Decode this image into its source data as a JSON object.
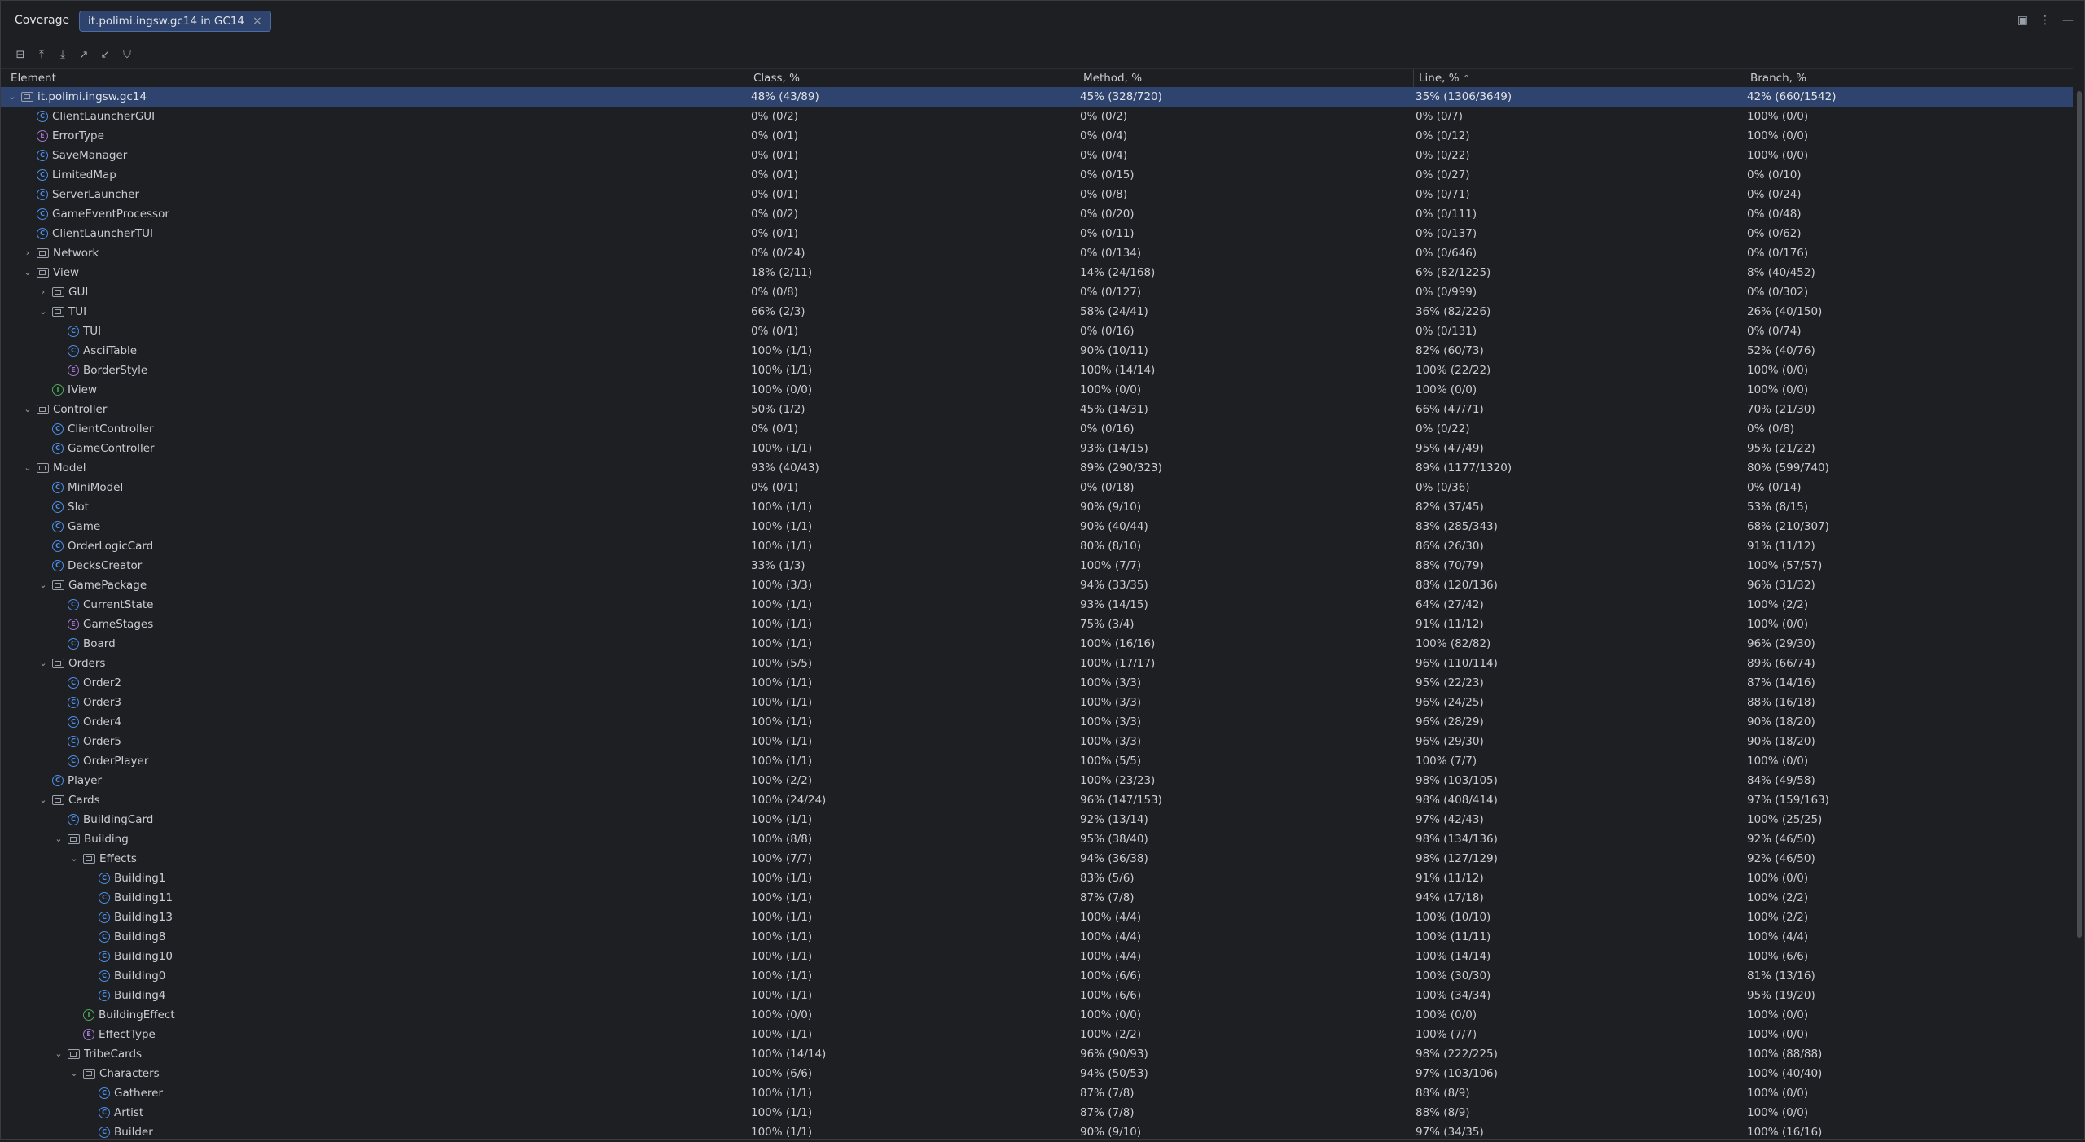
{
  "window": {
    "title": "Coverage",
    "tab_label": "it.polimi.ingsw.gc14 in GC14",
    "tab_close": "×"
  },
  "top_icons": [
    "layout-icon",
    "more-vertical-icon",
    "minimize-icon"
  ],
  "toolbar": [
    "import-icon",
    "collapse-all-icon",
    "expand-all-icon",
    "export-icon",
    "navigate-icon",
    "filter-icon"
  ],
  "columns": {
    "element": "Element",
    "class": "Class, %",
    "method": "Method, %",
    "line": "Line, %",
    "line_sort": "^",
    "branch": "Branch, %"
  },
  "rows": [
    {
      "name": "it.polimi.ingsw.gc14",
      "type": "pkg",
      "level": 0,
      "exp": "open",
      "class": "48% (43/89)",
      "method": "45% (328/720)",
      "line": "35% (1306/3649)",
      "branch": "42% (660/1542)",
      "sel": true
    },
    {
      "name": "ClientLauncherGUI",
      "type": "class",
      "level": 1,
      "exp": "",
      "class": "0% (0/2)",
      "method": "0% (0/2)",
      "line": "0% (0/7)",
      "branch": "100% (0/0)"
    },
    {
      "name": "ErrorType",
      "type": "enum",
      "level": 1,
      "exp": "",
      "class": "0% (0/1)",
      "method": "0% (0/4)",
      "line": "0% (0/12)",
      "branch": "100% (0/0)"
    },
    {
      "name": "SaveManager",
      "type": "class",
      "level": 1,
      "exp": "",
      "class": "0% (0/1)",
      "method": "0% (0/4)",
      "line": "0% (0/22)",
      "branch": "100% (0/0)"
    },
    {
      "name": "LimitedMap",
      "type": "class",
      "level": 1,
      "exp": "",
      "class": "0% (0/1)",
      "method": "0% (0/15)",
      "line": "0% (0/27)",
      "branch": "0% (0/10)"
    },
    {
      "name": "ServerLauncher",
      "type": "class",
      "level": 1,
      "exp": "",
      "class": "0% (0/1)",
      "method": "0% (0/8)",
      "line": "0% (0/71)",
      "branch": "0% (0/24)"
    },
    {
      "name": "GameEventProcessor",
      "type": "class",
      "level": 1,
      "exp": "",
      "class": "0% (0/2)",
      "method": "0% (0/20)",
      "line": "0% (0/111)",
      "branch": "0% (0/48)"
    },
    {
      "name": "ClientLauncherTUI",
      "type": "class",
      "level": 1,
      "exp": "",
      "class": "0% (0/1)",
      "method": "0% (0/11)",
      "line": "0% (0/137)",
      "branch": "0% (0/62)"
    },
    {
      "name": "Network",
      "type": "pkg",
      "level": 1,
      "exp": "closed",
      "class": "0% (0/24)",
      "method": "0% (0/134)",
      "line": "0% (0/646)",
      "branch": "0% (0/176)"
    },
    {
      "name": "View",
      "type": "pkg",
      "level": 1,
      "exp": "open",
      "class": "18% (2/11)",
      "method": "14% (24/168)",
      "line": "6% (82/1225)",
      "branch": "8% (40/452)"
    },
    {
      "name": "GUI",
      "type": "pkg",
      "level": 2,
      "exp": "closed",
      "class": "0% (0/8)",
      "method": "0% (0/127)",
      "line": "0% (0/999)",
      "branch": "0% (0/302)"
    },
    {
      "name": "TUI",
      "type": "pkg",
      "level": 2,
      "exp": "open",
      "class": "66% (2/3)",
      "method": "58% (24/41)",
      "line": "36% (82/226)",
      "branch": "26% (40/150)"
    },
    {
      "name": "TUI",
      "type": "class",
      "level": 3,
      "exp": "",
      "class": "0% (0/1)",
      "method": "0% (0/16)",
      "line": "0% (0/131)",
      "branch": "0% (0/74)"
    },
    {
      "name": "AsciiTable",
      "type": "class",
      "level": 3,
      "exp": "",
      "class": "100% (1/1)",
      "method": "90% (10/11)",
      "line": "82% (60/73)",
      "branch": "52% (40/76)"
    },
    {
      "name": "BorderStyle",
      "type": "enum",
      "level": 3,
      "exp": "",
      "class": "100% (1/1)",
      "method": "100% (14/14)",
      "line": "100% (22/22)",
      "branch": "100% (0/0)"
    },
    {
      "name": "IView",
      "type": "iface",
      "level": 2,
      "exp": "",
      "class": "100% (0/0)",
      "method": "100% (0/0)",
      "line": "100% (0/0)",
      "branch": "100% (0/0)"
    },
    {
      "name": "Controller",
      "type": "pkg",
      "level": 1,
      "exp": "open",
      "class": "50% (1/2)",
      "method": "45% (14/31)",
      "line": "66% (47/71)",
      "branch": "70% (21/30)"
    },
    {
      "name": "ClientController",
      "type": "class",
      "level": 2,
      "exp": "",
      "class": "0% (0/1)",
      "method": "0% (0/16)",
      "line": "0% (0/22)",
      "branch": "0% (0/8)"
    },
    {
      "name": "GameController",
      "type": "class",
      "level": 2,
      "exp": "",
      "class": "100% (1/1)",
      "method": "93% (14/15)",
      "line": "95% (47/49)",
      "branch": "95% (21/22)"
    },
    {
      "name": "Model",
      "type": "pkg",
      "level": 1,
      "exp": "open",
      "class": "93% (40/43)",
      "method": "89% (290/323)",
      "line": "89% (1177/1320)",
      "branch": "80% (599/740)"
    },
    {
      "name": "MiniModel",
      "type": "class",
      "level": 2,
      "exp": "",
      "class": "0% (0/1)",
      "method": "0% (0/18)",
      "line": "0% (0/36)",
      "branch": "0% (0/14)"
    },
    {
      "name": "Slot",
      "type": "class",
      "level": 2,
      "exp": "",
      "class": "100% (1/1)",
      "method": "90% (9/10)",
      "line": "82% (37/45)",
      "branch": "53% (8/15)"
    },
    {
      "name": "Game",
      "type": "class",
      "level": 2,
      "exp": "",
      "class": "100% (1/1)",
      "method": "90% (40/44)",
      "line": "83% (285/343)",
      "branch": "68% (210/307)"
    },
    {
      "name": "OrderLogicCard",
      "type": "class",
      "level": 2,
      "exp": "",
      "class": "100% (1/1)",
      "method": "80% (8/10)",
      "line": "86% (26/30)",
      "branch": "91% (11/12)"
    },
    {
      "name": "DecksCreator",
      "type": "class",
      "level": 2,
      "exp": "",
      "class": "33% (1/3)",
      "method": "100% (7/7)",
      "line": "88% (70/79)",
      "branch": "100% (57/57)"
    },
    {
      "name": "GamePackage",
      "type": "pkg",
      "level": 2,
      "exp": "open",
      "class": "100% (3/3)",
      "method": "94% (33/35)",
      "line": "88% (120/136)",
      "branch": "96% (31/32)"
    },
    {
      "name": "CurrentState",
      "type": "class",
      "level": 3,
      "exp": "",
      "class": "100% (1/1)",
      "method": "93% (14/15)",
      "line": "64% (27/42)",
      "branch": "100% (2/2)"
    },
    {
      "name": "GameStages",
      "type": "enum",
      "level": 3,
      "exp": "",
      "class": "100% (1/1)",
      "method": "75% (3/4)",
      "line": "91% (11/12)",
      "branch": "100% (0/0)"
    },
    {
      "name": "Board",
      "type": "class",
      "level": 3,
      "exp": "",
      "class": "100% (1/1)",
      "method": "100% (16/16)",
      "line": "100% (82/82)",
      "branch": "96% (29/30)"
    },
    {
      "name": "Orders",
      "type": "pkg",
      "level": 2,
      "exp": "open",
      "class": "100% (5/5)",
      "method": "100% (17/17)",
      "line": "96% (110/114)",
      "branch": "89% (66/74)"
    },
    {
      "name": "Order2",
      "type": "class",
      "level": 3,
      "exp": "",
      "class": "100% (1/1)",
      "method": "100% (3/3)",
      "line": "95% (22/23)",
      "branch": "87% (14/16)"
    },
    {
      "name": "Order3",
      "type": "class",
      "level": 3,
      "exp": "",
      "class": "100% (1/1)",
      "method": "100% (3/3)",
      "line": "96% (24/25)",
      "branch": "88% (16/18)"
    },
    {
      "name": "Order4",
      "type": "class",
      "level": 3,
      "exp": "",
      "class": "100% (1/1)",
      "method": "100% (3/3)",
      "line": "96% (28/29)",
      "branch": "90% (18/20)"
    },
    {
      "name": "Order5",
      "type": "class",
      "level": 3,
      "exp": "",
      "class": "100% (1/1)",
      "method": "100% (3/3)",
      "line": "96% (29/30)",
      "branch": "90% (18/20)"
    },
    {
      "name": "OrderPlayer",
      "type": "class",
      "level": 3,
      "exp": "",
      "class": "100% (1/1)",
      "method": "100% (5/5)",
      "line": "100% (7/7)",
      "branch": "100% (0/0)"
    },
    {
      "name": "Player",
      "type": "class",
      "level": 2,
      "exp": "",
      "class": "100% (2/2)",
      "method": "100% (23/23)",
      "line": "98% (103/105)",
      "branch": "84% (49/58)"
    },
    {
      "name": "Cards",
      "type": "pkg",
      "level": 2,
      "exp": "open",
      "class": "100% (24/24)",
      "method": "96% (147/153)",
      "line": "98% (408/414)",
      "branch": "97% (159/163)"
    },
    {
      "name": "BuildingCard",
      "type": "class",
      "level": 3,
      "exp": "",
      "class": "100% (1/1)",
      "method": "92% (13/14)",
      "line": "97% (42/43)",
      "branch": "100% (25/25)"
    },
    {
      "name": "Building",
      "type": "pkg",
      "level": 3,
      "exp": "open",
      "class": "100% (8/8)",
      "method": "95% (38/40)",
      "line": "98% (134/136)",
      "branch": "92% (46/50)"
    },
    {
      "name": "Effects",
      "type": "pkg",
      "level": 4,
      "exp": "open",
      "class": "100% (7/7)",
      "method": "94% (36/38)",
      "line": "98% (127/129)",
      "branch": "92% (46/50)"
    },
    {
      "name": "Building1",
      "type": "class",
      "level": 5,
      "exp": "",
      "class": "100% (1/1)",
      "method": "83% (5/6)",
      "line": "91% (11/12)",
      "branch": "100% (0/0)"
    },
    {
      "name": "Building11",
      "type": "class",
      "level": 5,
      "exp": "",
      "class": "100% (1/1)",
      "method": "87% (7/8)",
      "line": "94% (17/18)",
      "branch": "100% (2/2)"
    },
    {
      "name": "Building13",
      "type": "class",
      "level": 5,
      "exp": "",
      "class": "100% (1/1)",
      "method": "100% (4/4)",
      "line": "100% (10/10)",
      "branch": "100% (2/2)"
    },
    {
      "name": "Building8",
      "type": "class",
      "level": 5,
      "exp": "",
      "class": "100% (1/1)",
      "method": "100% (4/4)",
      "line": "100% (11/11)",
      "branch": "100% (4/4)"
    },
    {
      "name": "Building10",
      "type": "class",
      "level": 5,
      "exp": "",
      "class": "100% (1/1)",
      "method": "100% (4/4)",
      "line": "100% (14/14)",
      "branch": "100% (6/6)"
    },
    {
      "name": "Building0",
      "type": "class",
      "level": 5,
      "exp": "",
      "class": "100% (1/1)",
      "method": "100% (6/6)",
      "line": "100% (30/30)",
      "branch": "81% (13/16)"
    },
    {
      "name": "Building4",
      "type": "class",
      "level": 5,
      "exp": "",
      "class": "100% (1/1)",
      "method": "100% (6/6)",
      "line": "100% (34/34)",
      "branch": "95% (19/20)"
    },
    {
      "name": "BuildingEffect",
      "type": "iface",
      "level": 4,
      "exp": "",
      "class": "100% (0/0)",
      "method": "100% (0/0)",
      "line": "100% (0/0)",
      "branch": "100% (0/0)"
    },
    {
      "name": "EffectType",
      "type": "enum",
      "level": 4,
      "exp": "",
      "class": "100% (1/1)",
      "method": "100% (2/2)",
      "line": "100% (7/7)",
      "branch": "100% (0/0)"
    },
    {
      "name": "TribeCards",
      "type": "pkg",
      "level": 3,
      "exp": "open",
      "class": "100% (14/14)",
      "method": "96% (90/93)",
      "line": "98% (222/225)",
      "branch": "100% (88/88)"
    },
    {
      "name": "Characters",
      "type": "pkg",
      "level": 4,
      "exp": "open",
      "class": "100% (6/6)",
      "method": "94% (50/53)",
      "line": "97% (103/106)",
      "branch": "100% (40/40)"
    },
    {
      "name": "Gatherer",
      "type": "class",
      "level": 5,
      "exp": "",
      "class": "100% (1/1)",
      "method": "87% (7/8)",
      "line": "88% (8/9)",
      "branch": "100% (0/0)"
    },
    {
      "name": "Artist",
      "type": "class",
      "level": 5,
      "exp": "",
      "class": "100% (1/1)",
      "method": "87% (7/8)",
      "line": "88% (8/9)",
      "branch": "100% (0/0)"
    },
    {
      "name": "Builder",
      "type": "class",
      "level": 5,
      "exp": "",
      "class": "100% (1/1)",
      "method": "90% (9/10)",
      "line": "97% (34/35)",
      "branch": "100% (16/16)"
    }
  ],
  "colors": {
    "background": "#1e1f22",
    "selection": "#2e436e",
    "class_icon": "#4d8ee8",
    "enum_icon": "#a077cf",
    "interface_icon": "#4ea95b"
  }
}
